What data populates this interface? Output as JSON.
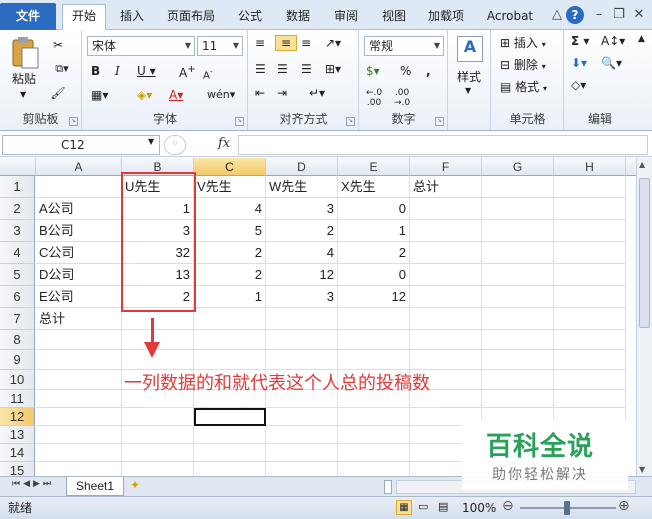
{
  "tabs": [
    {
      "label": "文件",
      "name": "tab-file"
    },
    {
      "label": "开始",
      "name": "tab-home"
    },
    {
      "label": "插入",
      "name": "tab-insert"
    },
    {
      "label": "页面布局",
      "name": "tab-page-layout"
    },
    {
      "label": "公式",
      "name": "tab-formulas"
    },
    {
      "label": "数据",
      "name": "tab-data"
    },
    {
      "label": "审阅",
      "name": "tab-review"
    },
    {
      "label": "视图",
      "name": "tab-view"
    },
    {
      "label": "加载项",
      "name": "tab-addins"
    },
    {
      "label": "Acrobat",
      "name": "tab-acrobat"
    }
  ],
  "ribbon": {
    "clipboard": {
      "paste": "粘贴",
      "label": "剪贴板"
    },
    "font": {
      "name": "宋体",
      "size": "11",
      "label": "字体"
    },
    "alignment": {
      "label": "对齐方式"
    },
    "number": {
      "format": "常规",
      "label": "数字"
    },
    "styles": {
      "label": "样式"
    },
    "cells": {
      "insert": "插入",
      "delete": "删除",
      "format": "格式",
      "label": "单元格"
    },
    "editing": {
      "label": "编辑"
    }
  },
  "formula_bar": {
    "name_box": "C12",
    "fx": "fx",
    "formula": ""
  },
  "columns": [
    "A",
    "B",
    "C",
    "D",
    "E",
    "F",
    "G",
    "H"
  ],
  "rows": [
    "1",
    "2",
    "3",
    "4",
    "5",
    "6",
    "7",
    "8",
    "9",
    "10",
    "11",
    "12",
    "13",
    "14",
    "15"
  ],
  "cells": {
    "r1": [
      "",
      "U先生",
      "V先生",
      "W先生",
      "X先生",
      "总计"
    ],
    "r2": [
      "A公司",
      "1",
      "4",
      "3",
      "0"
    ],
    "r3": [
      "B公司",
      "3",
      "5",
      "2",
      "1"
    ],
    "r4": [
      "C公司",
      "32",
      "2",
      "4",
      "2"
    ],
    "r5": [
      "D公司",
      "13",
      "2",
      "12",
      "0"
    ],
    "r6": [
      "E公司",
      "2",
      "1",
      "3",
      "12"
    ],
    "r7": [
      "总计"
    ]
  },
  "annotation": "一列数据的和就代表这个人总的投稿数",
  "sheet_tab": "Sheet1",
  "status": {
    "mode": "就绪",
    "zoom": "100%"
  },
  "watermark": {
    "title": "百科全说",
    "subtitle": "助你轻松解决"
  },
  "colors": {
    "accent": "#2c6cc0",
    "annotation": "#e03a3a",
    "watermark": "#2aa05a"
  }
}
